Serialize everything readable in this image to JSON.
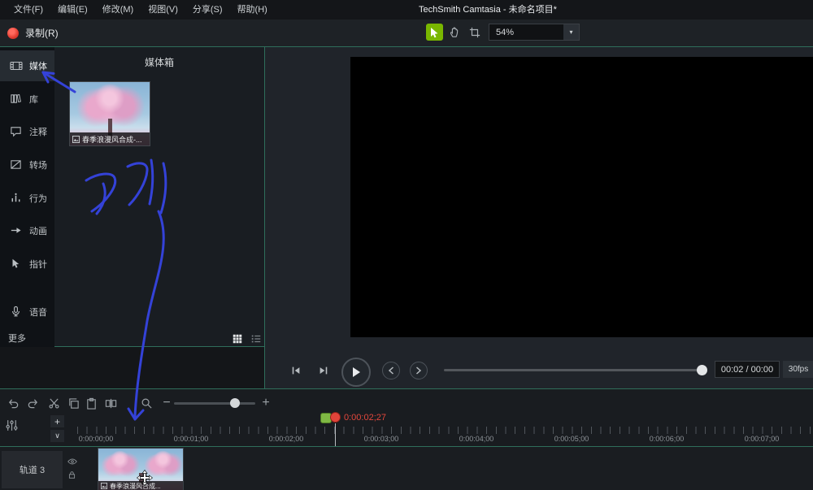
{
  "window": {
    "title": "TechSmith Camtasia - 未命名项目*"
  },
  "menubar": {
    "items": [
      {
        "label": "文件(F)"
      },
      {
        "label": "编辑(E)"
      },
      {
        "label": "修改(M)"
      },
      {
        "label": "视图(V)"
      },
      {
        "label": "分享(S)"
      },
      {
        "label": "帮助(H)"
      }
    ]
  },
  "toolbar": {
    "record_label": "录制(R)",
    "zoom_value": "54%"
  },
  "sidebar": {
    "items": [
      {
        "label": "媒体"
      },
      {
        "label": "库"
      },
      {
        "label": "注释"
      },
      {
        "label": "转场"
      },
      {
        "label": "行为"
      },
      {
        "label": "动画"
      },
      {
        "label": "指针"
      },
      {
        "label": "语音"
      }
    ],
    "more_label": "更多"
  },
  "media_bin": {
    "title": "媒体箱",
    "item_label": "春季浪漫风合成-..."
  },
  "annotations": {
    "handwriting": "刀引",
    "color": "#3442d8"
  },
  "preview": {
    "time_display": "00:02 / 00:00",
    "fps": "30fps"
  },
  "timeline": {
    "playhead_time": "0:00:02;27",
    "ruler_labels": [
      "0:00:00;00",
      "0:00:01;00",
      "0:00:02;00",
      "0:00:03;00",
      "0:00:04;00",
      "0:00:05;00",
      "0:00:06;00",
      "0:00:07;00"
    ],
    "track_label": "轨道 3",
    "clip_label": "春季浪漫风合成..."
  },
  "glyphs": {
    "dropdown": "▾",
    "plus": "+",
    "minus": "−",
    "chevron_down": "∨"
  },
  "colors": {
    "accent_green": "#79b700",
    "teal_border": "#2f6e5b",
    "record_red": "#e23b30",
    "playhead_red": "#e4473c",
    "annotation_blue": "#3442d8"
  }
}
